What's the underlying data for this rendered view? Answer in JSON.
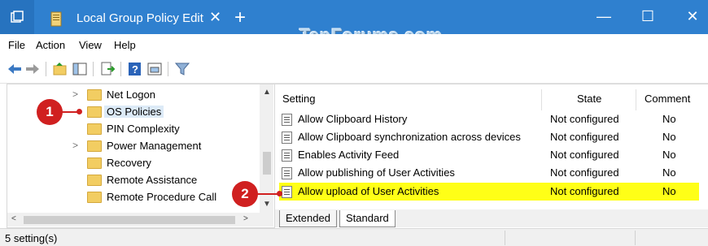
{
  "window": {
    "tab_title": "Local Group Policy Edit",
    "close_tab_glyph": "✕",
    "new_tab_glyph": "+",
    "watermark": "TenForums.com",
    "minimize_glyph": "—",
    "maximize_glyph": "☐",
    "close_glyph": "✕"
  },
  "menu": {
    "items": [
      "File",
      "Action",
      "View",
      "Help"
    ]
  },
  "toolbar": {
    "icons": [
      "back-icon",
      "forward-icon",
      "up-folder-icon",
      "show-hide-tree-icon",
      "export-list-icon",
      "help-icon",
      "properties-icon",
      "filter-icon"
    ]
  },
  "tree": {
    "items": [
      {
        "label": "Net Logon",
        "expandable": true,
        "selected": false
      },
      {
        "label": "OS Policies",
        "expandable": false,
        "selected": true
      },
      {
        "label": "PIN Complexity",
        "expandable": false,
        "selected": false
      },
      {
        "label": "Power Management",
        "expandable": true,
        "selected": false
      },
      {
        "label": "Recovery",
        "expandable": false,
        "selected": false
      },
      {
        "label": "Remote Assistance",
        "expandable": false,
        "selected": false
      },
      {
        "label": "Remote Procedure Call",
        "expandable": false,
        "selected": false
      }
    ]
  },
  "annotations": {
    "badge1": "1",
    "badge2": "2"
  },
  "list": {
    "columns": {
      "setting": "Setting",
      "state": "State",
      "comment": "Comment"
    },
    "rows": [
      {
        "setting": "Allow Clipboard History",
        "state": "Not configured",
        "comment": "No",
        "highlighted": false
      },
      {
        "setting": "Allow Clipboard synchronization across devices",
        "state": "Not configured",
        "comment": "No",
        "highlighted": false
      },
      {
        "setting": "Enables Activity Feed",
        "state": "Not configured",
        "comment": "No",
        "highlighted": false
      },
      {
        "setting": "Allow publishing of User Activities",
        "state": "Not configured",
        "comment": "No",
        "highlighted": false
      },
      {
        "setting": "Allow upload of User Activities",
        "state": "Not configured",
        "comment": "No",
        "highlighted": true
      }
    ]
  },
  "view_tabs": {
    "extended": "Extended",
    "standard": "Standard",
    "active": "standard"
  },
  "status": {
    "text": "5 setting(s)"
  },
  "colors": {
    "titlebar": "#2f80cf",
    "highlight": "#ffff17",
    "badge": "#d02020",
    "folder": "#f2cd62"
  }
}
